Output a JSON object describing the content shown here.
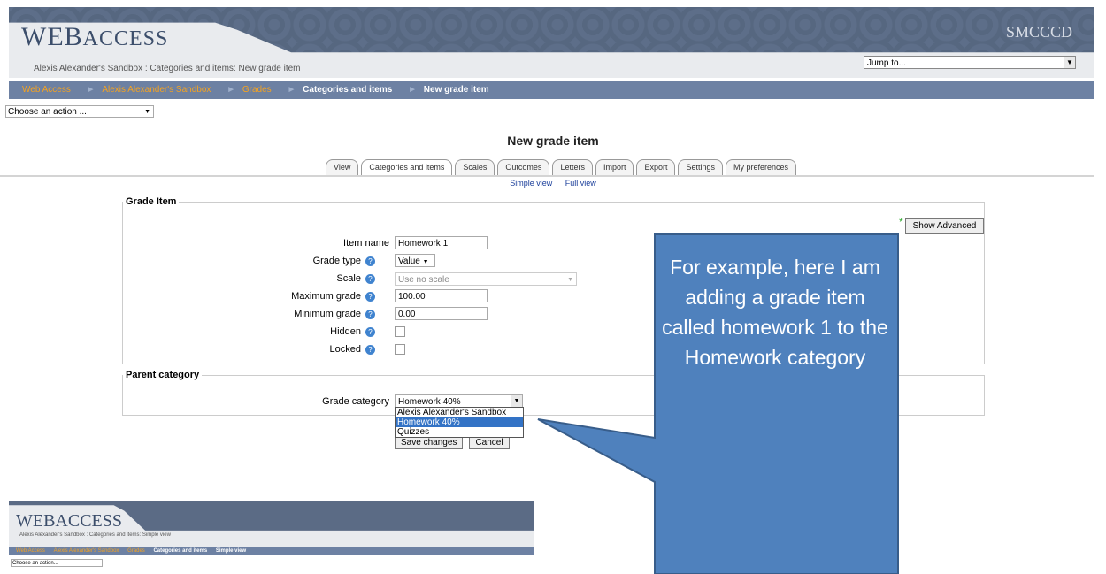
{
  "header": {
    "logo_main": "WEB",
    "logo_rest": "ACCESS",
    "subtitle": "Alexis Alexander's Sandbox : Categories and items: New grade item",
    "org": "SMCCCD",
    "jump_to": "Jump to..."
  },
  "breadcrumb": {
    "items": [
      "Web Access",
      "Alexis Alexander's Sandbox",
      "Grades",
      "Categories and items",
      "New grade item"
    ]
  },
  "action_select": "Choose an action ...",
  "page_title": "New grade item",
  "tabs": [
    "View",
    "Categories and items",
    "Scales",
    "Outcomes",
    "Letters",
    "Import",
    "Export",
    "Settings",
    "My preferences"
  ],
  "subtabs": [
    "Simple view",
    "Full view"
  ],
  "grade_item": {
    "legend": "Grade Item",
    "show_advanced": "Show Advanced",
    "item_name_label": "Item name",
    "item_name_value": "Homework 1",
    "grade_type_label": "Grade type",
    "grade_type_value": "Value",
    "scale_label": "Scale",
    "scale_value": "Use no scale",
    "max_grade_label": "Maximum grade",
    "max_grade_value": "100.00",
    "min_grade_label": "Minimum grade",
    "min_grade_value": "0.00",
    "hidden_label": "Hidden",
    "locked_label": "Locked"
  },
  "parent_category": {
    "legend": "Parent category",
    "grade_category_label": "Grade category",
    "selected": "Homework 40%",
    "options": [
      "Alexis Alexander's Sandbox",
      "Homework 40%",
      "Quizzes"
    ]
  },
  "buttons": {
    "save": "Save changes",
    "cancel": "Cancel"
  },
  "callout": {
    "text": "For example, here I am adding a grade item called homework 1 to the Homework category",
    "color": "#4f81bd"
  },
  "thumbnail": {
    "logo": "WEBACCESS",
    "subtitle": "Alexis Alexander's Sandbox : Categories and items: Simple view",
    "breadcrumb": [
      "Web Access",
      "Alexis Alexander's Sandbox",
      "Grades",
      "Categories and items",
      "Simple view"
    ],
    "action_select": "Choose an action..."
  }
}
